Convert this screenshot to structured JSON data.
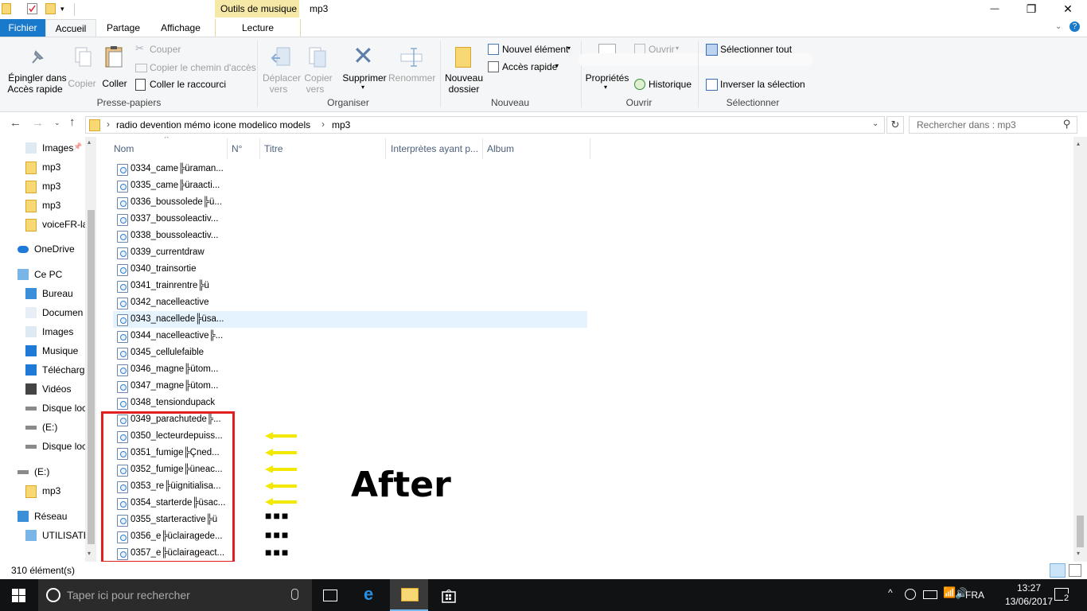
{
  "window": {
    "title": "mp3",
    "context_group": "Outils de musique",
    "controls": {
      "minimize": "—",
      "maximize": "❐",
      "close": "✕"
    }
  },
  "tabs": [
    {
      "label": "Fichier"
    },
    {
      "label": "Accueil"
    },
    {
      "label": "Partage"
    },
    {
      "label": "Affichage"
    },
    {
      "label": "Lecture"
    }
  ],
  "ribbon": {
    "presse_papiers": {
      "pin_label_1": "Épingler dans",
      "pin_label_2": "Accès rapide",
      "copy": "Copier",
      "paste": "Coller",
      "cut": "Couper",
      "copy_path": "Copier le chemin d'accès",
      "paste_shortcut": "Coller le raccourci",
      "group": "Presse-papiers"
    },
    "organiser": {
      "move_1": "Déplacer",
      "move_2": "vers",
      "copy_1": "Copier",
      "copy_2": "vers",
      "delete": "Supprimer",
      "rename": "Renommer",
      "group": "Organiser"
    },
    "nouveau": {
      "new_folder_1": "Nouveau",
      "new_folder_2": "dossier",
      "new_item": "Nouvel élément",
      "quick_access": "Accès rapide",
      "group": "Nouveau"
    },
    "ouvrir": {
      "open": "Ouvrir",
      "properties": "Propriétés",
      "history": "Historique",
      "group": "Ouvrir"
    },
    "selectionner": {
      "select_all": "Sélectionner tout",
      "invert": "Inverser la sélection",
      "group": "Sélectionner"
    }
  },
  "address": {
    "path_root": "radio devention mémo icone modelico models",
    "path_leaf": "mp3",
    "separator": "›",
    "search_placeholder": "Rechercher dans : mp3"
  },
  "nav": {
    "items": [
      {
        "label": "Images",
        "icon": "images-icon"
      },
      {
        "label": "mp3",
        "icon": "folder-icon"
      },
      {
        "label": "mp3",
        "icon": "folder-icon"
      },
      {
        "label": "mp3",
        "icon": "folder-icon"
      },
      {
        "label": "voiceFR-la",
        "icon": "folder-icon"
      },
      {
        "label": "OneDrive",
        "icon": "cloud-icon"
      },
      {
        "label": "Ce PC",
        "icon": "computer-icon"
      },
      {
        "label": "Bureau",
        "icon": "desktop-icon"
      },
      {
        "label": "Documen",
        "icon": "documents-icon"
      },
      {
        "label": "Images",
        "icon": "images-icon"
      },
      {
        "label": "Musique",
        "icon": "music-icon"
      },
      {
        "label": "Télécharg",
        "icon": "download-icon"
      },
      {
        "label": "Vidéos",
        "icon": "video-icon"
      },
      {
        "label": "Disque loc",
        "icon": "drive-icon"
      },
      {
        "label": "(E:)",
        "icon": "drive-icon"
      },
      {
        "label": "Disque loc",
        "icon": "drive-icon"
      },
      {
        "label": "(E:)",
        "icon": "drive-icon"
      },
      {
        "label": "mp3",
        "icon": "folder-icon"
      },
      {
        "label": "Réseau",
        "icon": "network-icon"
      },
      {
        "label": "UTILISATE",
        "icon": "computer-icon"
      }
    ]
  },
  "columns": [
    "Nom",
    "N°",
    "Titre",
    "Interprètes ayant p...",
    "Album"
  ],
  "files": [
    "0334_came╠üraman...",
    "0335_came╠üraacti...",
    "0336_boussolede╠ü...",
    "0337_boussoleactiv...",
    "0338_boussoleactiv...",
    "0339_currentdraw",
    "0340_trainsortie",
    "0341_trainrentre╠ü",
    "0342_nacelleactive",
    "0343_nacellede╠üsa...",
    "0344_nacelleactive╠...",
    "0345_cellulefaible",
    "0346_magne╠ütom...",
    "0347_magne╠ütom...",
    "0348_tensiondupack",
    "0349_parachutede╠...",
    "0350_lecteurdepuiss...",
    "0351_fumige╠Çned...",
    "0352_fumige╠üneac...",
    "0353_re╠üignitialisa...",
    "0354_starterde╠üsac...",
    "0355_starteractive╠ü",
    "0356_e╠üclairagede...",
    "0357_e╠üclairageact..."
  ],
  "selected_file_index": 9,
  "status": {
    "count": "310 élément(s)"
  },
  "annotation": {
    "label": "After",
    "dots": "■■■",
    "arrow_color": "#f3e800",
    "box_color": "#e02020"
  },
  "taskbar": {
    "search_placeholder": "Taper ici pour rechercher",
    "language": "FRA",
    "time": "13:27",
    "date": "13/06/2017",
    "notifications": "2"
  }
}
